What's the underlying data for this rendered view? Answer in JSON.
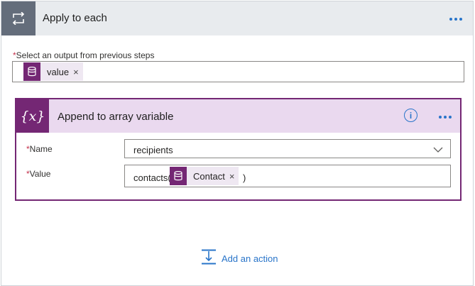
{
  "loop": {
    "title": "Apply to each",
    "icon": "loop-icon",
    "field": {
      "required_mark": "*",
      "label": "Select an output from previous steps",
      "token": {
        "label": "value",
        "icon": "dataverse-icon",
        "remove": "×"
      }
    }
  },
  "action": {
    "title": "Append to array variable",
    "icon_text": "{x}",
    "icon": "variable-icon",
    "name_field": {
      "required_mark": "*",
      "label": "Name",
      "value": "recipients"
    },
    "value_field": {
      "required_mark": "*",
      "label": "Value",
      "prefix": "contacts(",
      "token": {
        "label": "Contact",
        "icon": "dataverse-icon",
        "remove": "×"
      },
      "suffix": ")"
    }
  },
  "footer": {
    "add_action_label": "Add an action"
  },
  "colors": {
    "accent_blue": "#2874c9",
    "loop_icon_bg": "#646d7b",
    "variable_purple": "#742774",
    "variable_header_bg": "#ead9ef",
    "token_bg": "#efe8f2",
    "required_red": "#c4314b"
  }
}
